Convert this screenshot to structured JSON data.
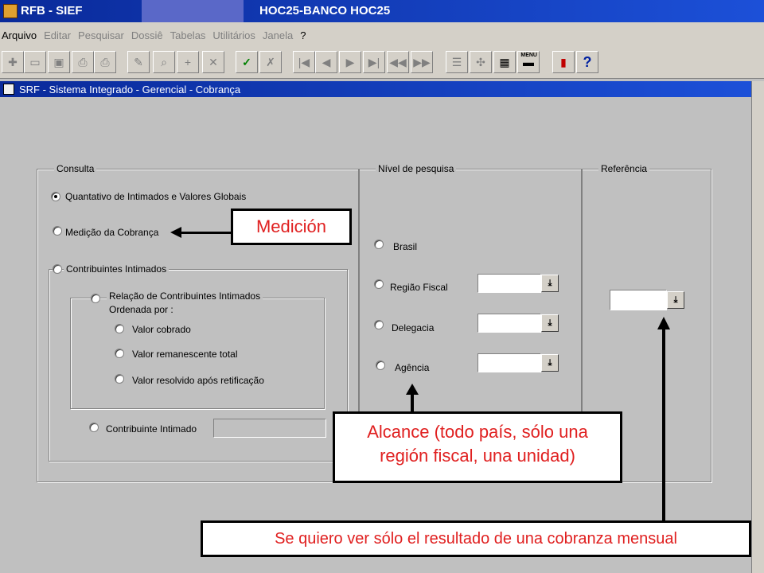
{
  "window": {
    "title_left": "RFB -  SIEF",
    "title_center": "HOC25-BANCO HOC25"
  },
  "menu": [
    {
      "label": "Arquivo",
      "enabled": true
    },
    {
      "label": "Editar",
      "enabled": false
    },
    {
      "label": "Pesquisar",
      "enabled": false
    },
    {
      "label": "Dossiê",
      "enabled": false
    },
    {
      "label": "Tabelas",
      "enabled": false
    },
    {
      "label": "Utilitários",
      "enabled": false
    },
    {
      "label": "Janela",
      "enabled": false
    },
    {
      "label": "?",
      "enabled": true
    }
  ],
  "toolbar": {
    "menu_badge": "MENU",
    "icons": [
      "new-icon",
      "open-icon",
      "save-icon",
      "print-icon",
      "print-preview-icon",
      "edit-icon",
      "query-icon",
      "add-icon",
      "delete-icon",
      "execute-query-icon",
      "cancel-query-icon",
      "first-record-icon",
      "previous-record-icon",
      "next-record-icon",
      "last-record-icon",
      "previous-set-icon",
      "next-set-icon",
      "notepad-icon",
      "tools-icon",
      "window-icon",
      "menu-icon",
      "exit-icon",
      "help-icon"
    ]
  },
  "form": {
    "title": "SRF - Sistema Integrado - Gerencial - Cobrança",
    "consulta": {
      "legend": "Consulta",
      "options": {
        "quantitativo": "Quantativo de Intimados e Valores Globais",
        "medicao": "Medição da Cobrança",
        "contribuintes": "Contribuintes Intimados"
      },
      "relacao_line1": "Relação de Contribuintes Intimados",
      "relacao_line2": "Ordenada por :",
      "ordenada": {
        "valor_cobrado": "Valor cobrado",
        "valor_remanescente": "Valor remanescente total",
        "valor_resolvido": "Valor resolvido após retificação"
      },
      "contribuinte_intimado": "Contribuinte Intimado"
    },
    "nivel": {
      "legend": "Nível de pesquisa",
      "brasil": "Brasil",
      "regiao": "Região Fiscal",
      "delegacia": "Delegacia",
      "agencia": "Agência"
    },
    "referencia": {
      "legend": "Referência"
    }
  },
  "annotations": {
    "medicion": "Medición",
    "alcance_line1": "Alcance (todo país, sólo una",
    "alcance_line2": "región fiscal, una unidad)",
    "mensual": "Se quiero ver sólo el resultado de una cobranza mensual"
  }
}
